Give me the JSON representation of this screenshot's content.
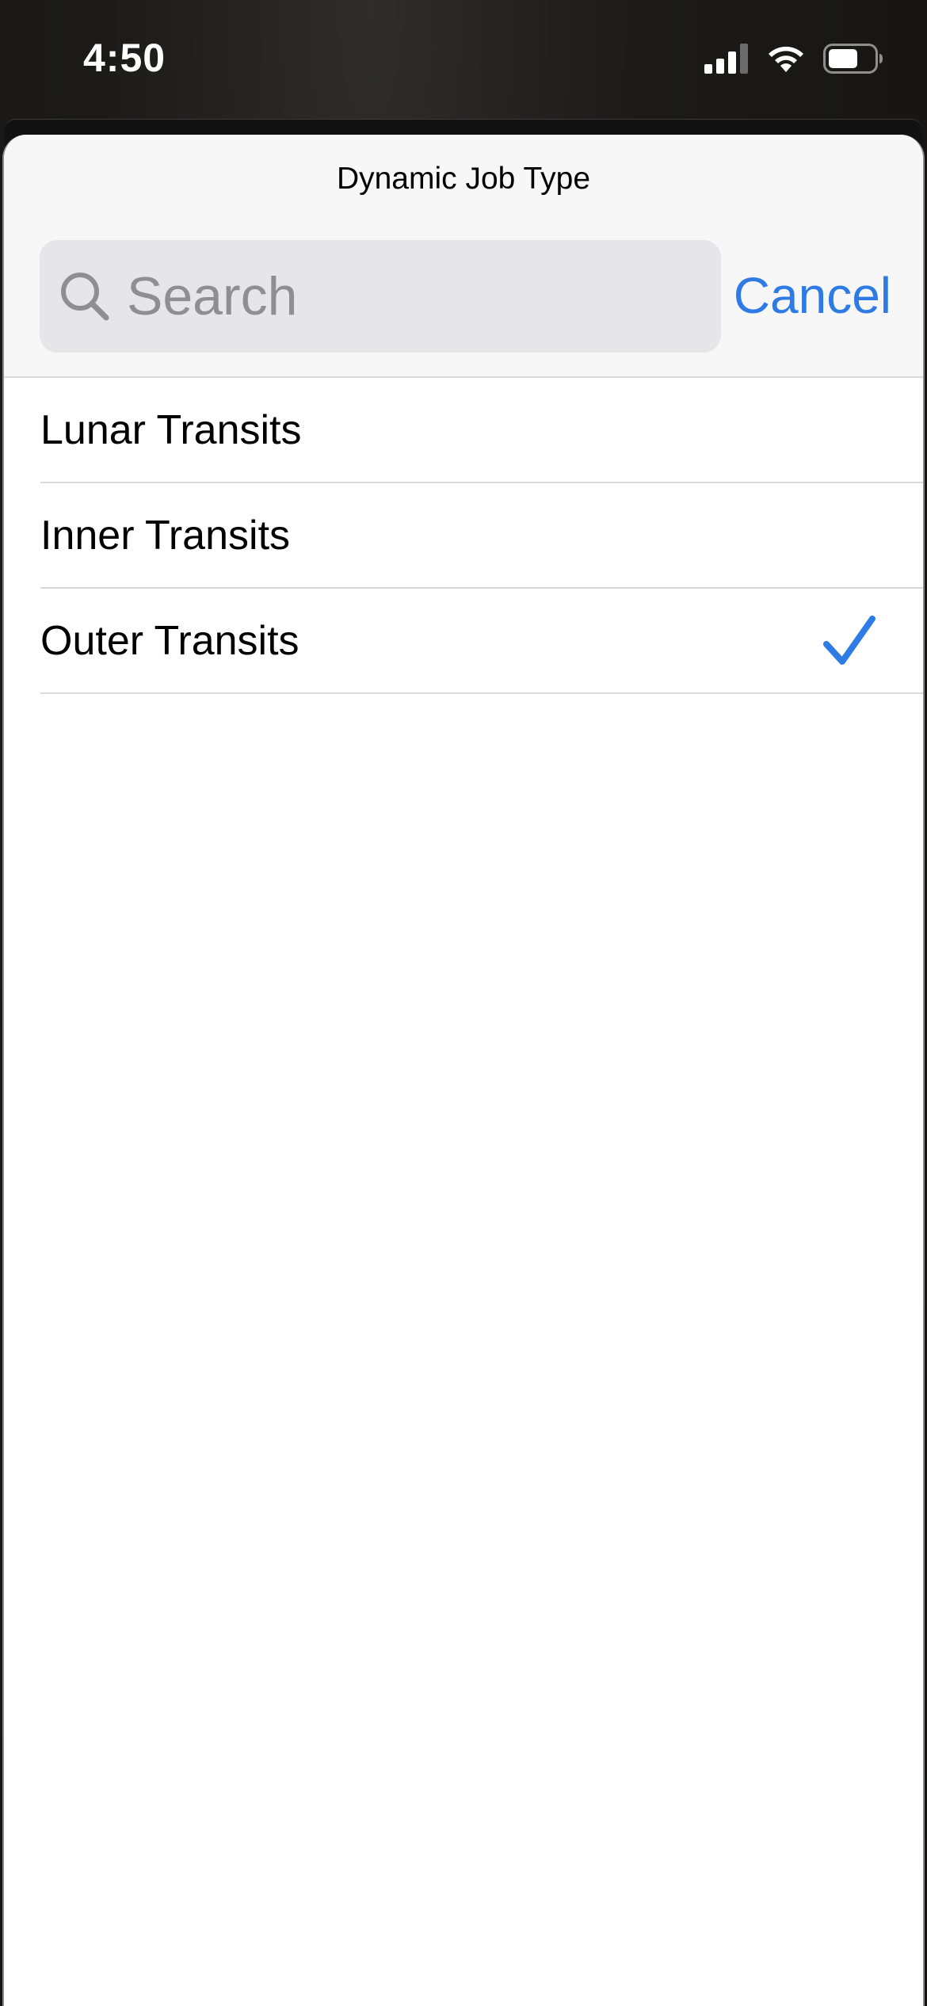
{
  "status_bar": {
    "time": "4:50",
    "icons": [
      "cellular-signal-icon",
      "wifi-icon",
      "battery-icon"
    ]
  },
  "sheet": {
    "title": "Dynamic Job Type",
    "search": {
      "placeholder": "Search",
      "value": ""
    },
    "cancel_label": "Cancel"
  },
  "list": {
    "items": [
      {
        "label": "Lunar Transits",
        "selected": false
      },
      {
        "label": "Inner Transits",
        "selected": false
      },
      {
        "label": "Outer Transits",
        "selected": true
      }
    ]
  },
  "colors": {
    "accent": "#2f7be6",
    "header_bg": "#f7f7f7",
    "search_bg": "#e6e6e8",
    "separator": "#d9d9d9",
    "placeholder": "#8e8e93"
  }
}
